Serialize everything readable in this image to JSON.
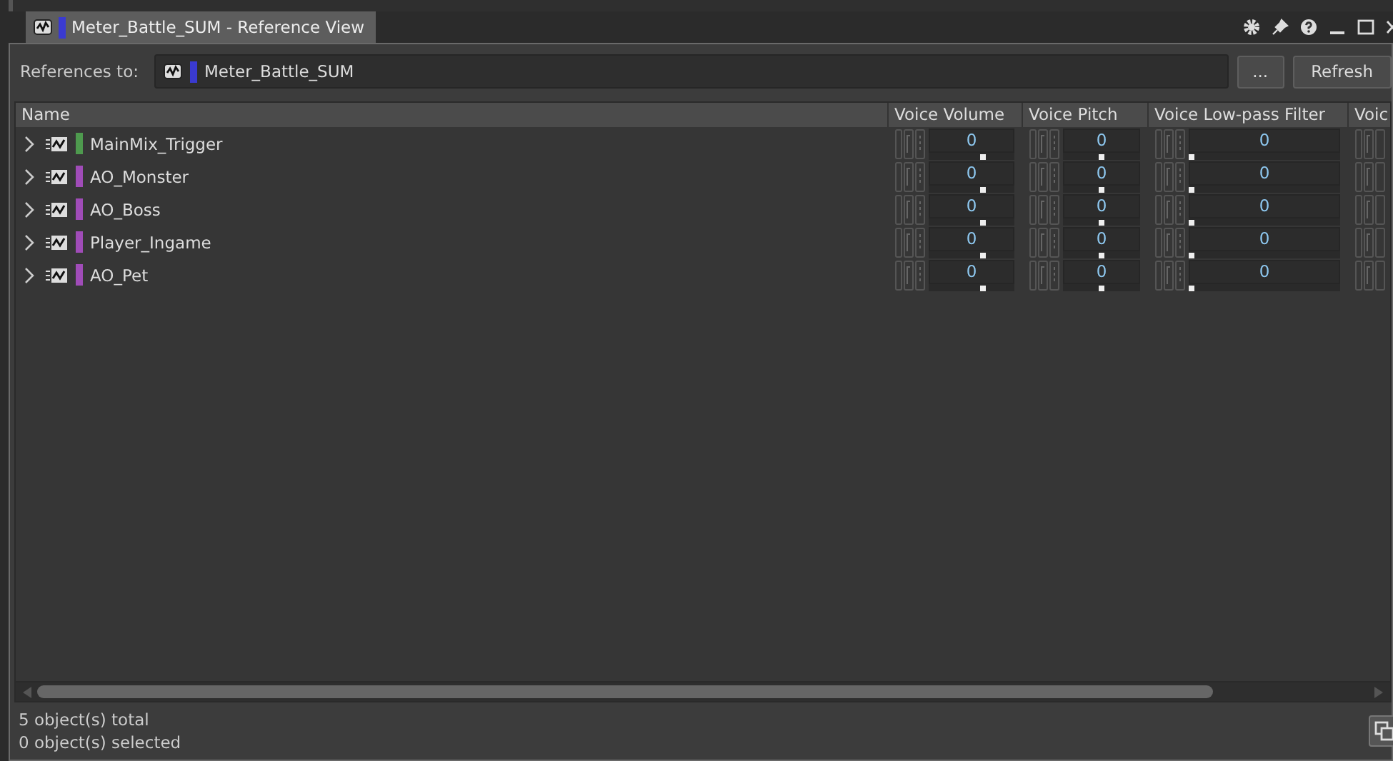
{
  "tab": {
    "title": "Meter_Battle_SUM - Reference View",
    "color": "#3a3ad0"
  },
  "references": {
    "label": "References to:",
    "value": "Meter_Battle_SUM",
    "color": "#3a3ad0",
    "browse_button": "...",
    "refresh_button": "Refresh"
  },
  "table": {
    "name_column": "Name",
    "property_columns": [
      "Voice Volume",
      "Voice Pitch",
      "Voice Low-pass Filter",
      "Voic"
    ],
    "rows": [
      {
        "name": "MainMix_Trigger",
        "color": "#4e9a4e",
        "expanded": false,
        "cells": [
          {
            "value": "0",
            "level": 0.65
          },
          {
            "value": "0",
            "level": 0.5
          },
          {
            "value": "0",
            "level": 0
          }
        ]
      },
      {
        "name": "AO_Monster",
        "color": "#a04cb8",
        "expanded": false,
        "cells": [
          {
            "value": "0",
            "level": 0.65
          },
          {
            "value": "0",
            "level": 0.5
          },
          {
            "value": "0",
            "level": 0
          }
        ]
      },
      {
        "name": "AO_Boss",
        "color": "#a04cb8",
        "expanded": false,
        "cells": [
          {
            "value": "0",
            "level": 0.65
          },
          {
            "value": "0",
            "level": 0.5
          },
          {
            "value": "0",
            "level": 0
          }
        ]
      },
      {
        "name": "Player_Ingame",
        "color": "#a04cb8",
        "expanded": false,
        "cells": [
          {
            "value": "0",
            "level": 0.65
          },
          {
            "value": "0",
            "level": 0.5
          },
          {
            "value": "0",
            "level": 0
          }
        ]
      },
      {
        "name": "AO_Pet",
        "color": "#a04cb8",
        "expanded": false,
        "cells": [
          {
            "value": "0",
            "level": 0.65
          },
          {
            "value": "0",
            "level": 0.5
          },
          {
            "value": "0",
            "level": 0
          }
        ]
      }
    ]
  },
  "status": [
    "5 object(s) total",
    "0 object(s) selected"
  ]
}
